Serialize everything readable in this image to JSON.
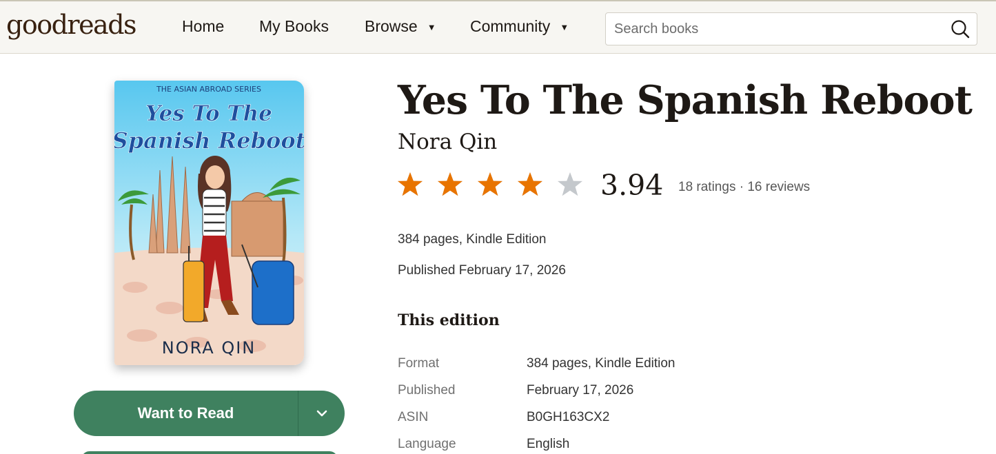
{
  "header": {
    "logo": "goodreads",
    "nav": [
      {
        "label": "Home"
      },
      {
        "label": "My Books"
      },
      {
        "label": "Browse",
        "caret": "▼"
      },
      {
        "label": "Community",
        "caret": "▼"
      }
    ],
    "search": {
      "placeholder": "Search books",
      "value": ""
    }
  },
  "cover": {
    "series": "THE ASIAN ABROAD SERIES",
    "title_line1": "Yes To The",
    "title_line2": "Spanish Reboot",
    "author": "NORA QIN"
  },
  "actions": {
    "want_to_read": "Want to Read"
  },
  "book": {
    "title": "Yes To The Spanish Reboot",
    "author": "Nora Qin",
    "rating": "3.94",
    "rating_value": 3.94,
    "ratings_count": "18 ratings",
    "separator": "·",
    "reviews_count": "16 reviews",
    "pages_format": "384 pages, Kindle Edition",
    "published": "Published February 17, 2026"
  },
  "edition": {
    "heading": "This edition",
    "rows": [
      {
        "key": "Format",
        "value": "384 pages, Kindle Edition"
      },
      {
        "key": "Published",
        "value": "February 17, 2026"
      },
      {
        "key": "ASIN",
        "value": "B0GH163CX2"
      },
      {
        "key": "Language",
        "value": "English"
      }
    ]
  },
  "colors": {
    "star_filled": "#e87400",
    "star_empty": "#c4c8cc",
    "button": "#3f815f",
    "logo": "#382110"
  }
}
